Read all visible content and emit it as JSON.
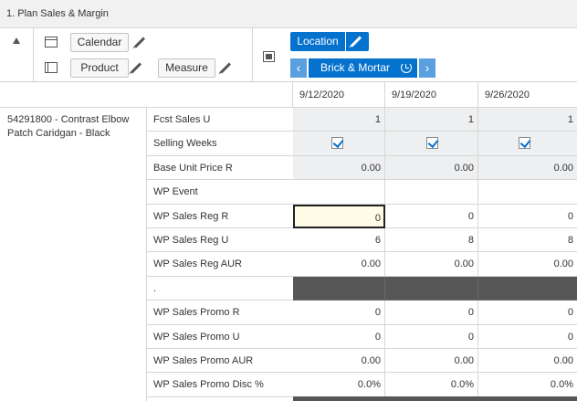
{
  "window": {
    "title": "1. Plan Sales & Margin"
  },
  "toolbar": {
    "calendar_label": "Calendar",
    "product_label": "Product",
    "measure_label": "Measure",
    "location_label": "Location",
    "location_value": "Brick & Mortar",
    "prev_glyph": "‹",
    "next_glyph": "›",
    "accent_color": "#0572ce"
  },
  "grid": {
    "columns": [
      "9/12/2020",
      "9/19/2020",
      "9/26/2020"
    ],
    "product": "54291800 - Contrast Elbow Patch Caridgan - Black",
    "rows": [
      {
        "label": "Fcst Sales U",
        "values": [
          "1",
          "1",
          "1"
        ]
      },
      {
        "label": "Selling Weeks",
        "values": [
          true,
          true,
          true
        ]
      },
      {
        "label": "Base Unit Price R",
        "values": [
          "0.00",
          "0.00",
          "0.00"
        ]
      },
      {
        "label": "WP Event",
        "values": [
          "",
          "",
          ""
        ]
      },
      {
        "label": "WP Sales Reg R",
        "values": [
          "0",
          "0",
          "0"
        ]
      },
      {
        "label": "WP Sales Reg U",
        "values": [
          "6",
          "8",
          "8"
        ]
      },
      {
        "label": "WP Sales Reg AUR",
        "values": [
          "0.00",
          "0.00",
          "0.00"
        ]
      },
      {
        "label": ".",
        "values": [
          "",
          "",
          ""
        ]
      },
      {
        "label": "WP Sales Promo R",
        "values": [
          "0",
          "0",
          "0"
        ]
      },
      {
        "label": "WP Sales Promo U",
        "values": [
          "0",
          "0",
          "0"
        ]
      },
      {
        "label": "WP Sales Promo AUR",
        "values": [
          "0.00",
          "0.00",
          "0.00"
        ]
      },
      {
        "label": "WP Sales Promo Disc %",
        "values": [
          "0.0%",
          "0.0%",
          "0.0%"
        ]
      }
    ]
  }
}
